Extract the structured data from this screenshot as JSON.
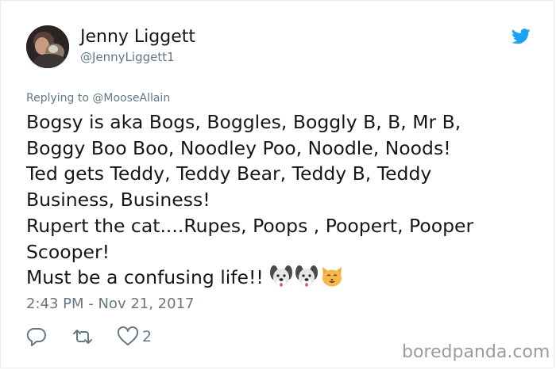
{
  "author": {
    "display_name": "Jenny Liggett",
    "handle": "@JennyLiggett1"
  },
  "replying_to": "Replying to @MooseAllain",
  "tweet": {
    "lines": [
      "Bogsy is aka Bogs, Boggles, Boggly B, B, Mr B,",
      "Boggy Boo Boo, Noodley Poo, Noodle, Noods!",
      "Ted gets Teddy, Teddy Bear, Teddy B, Teddy",
      "Business, Business!",
      "Rupert the cat....Rupes, Poops , Poopert, Pooper",
      "Scooper!",
      "Must be a confusing life!!"
    ],
    "emojis": [
      "dog-face-emoji",
      "dog-face-emoji",
      "cat-face-emoji"
    ]
  },
  "timestamp": "2:43 PM - Nov 21, 2017",
  "actions": {
    "reply_icon": "reply-icon",
    "retweet_icon": "retweet-icon",
    "like_icon": "heart-icon",
    "like_count": "2"
  },
  "watermark": "boredpanda.com",
  "colors": {
    "text": "#14171a",
    "secondary": "#657786",
    "twitter_blue": "#1da1f2",
    "watermark": "#9b9b9b"
  }
}
